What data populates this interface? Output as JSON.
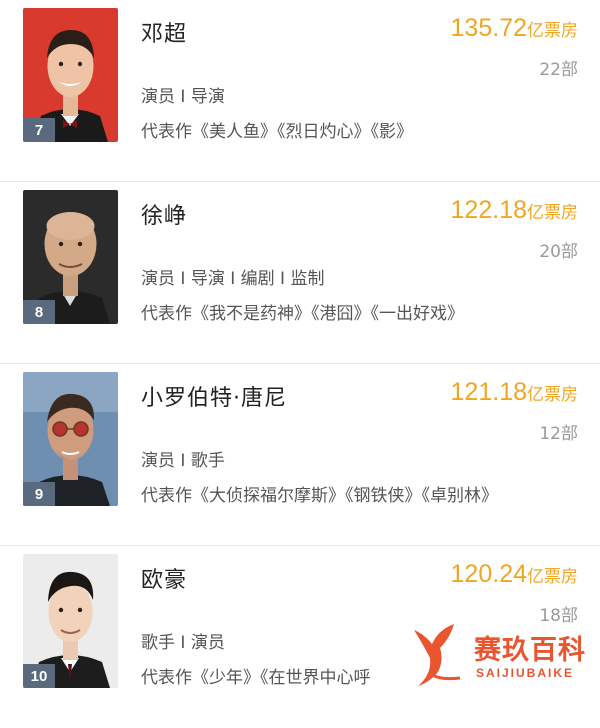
{
  "list": [
    {
      "name": "邓超",
      "box_office": "135.72",
      "box_office_unit": "亿票房",
      "film_count": "22部",
      "roles": "演员 I 导演",
      "works": "代表作《美人鱼》《烈日灼心》《影》",
      "rank": "7",
      "avatar_bg": "#d83a2e"
    },
    {
      "name": "徐峥",
      "box_office": "122.18",
      "box_office_unit": "亿票房",
      "film_count": "20部",
      "roles": "演员 I 导演 I 编剧 I 监制",
      "works": "代表作《我不是药神》《港囧》《一出好戏》",
      "rank": "8",
      "avatar_bg": "#2b2b2b"
    },
    {
      "name": "小罗伯特·唐尼",
      "box_office": "121.18",
      "box_office_unit": "亿票房",
      "film_count": "12部",
      "roles": "演员 I 歌手",
      "works": "代表作《大侦探福尔摩斯》《钢铁侠》《卓别林》",
      "rank": "9",
      "avatar_bg": "#6f8fb0"
    },
    {
      "name": "欧豪",
      "box_office": "120.24",
      "box_office_unit": "亿票房",
      "film_count": "18部",
      "roles": "歌手 I 演员",
      "works": "代表作《少年》《在世界中心呼",
      "rank": "10",
      "avatar_bg": "#ececec"
    }
  ],
  "watermark": {
    "title": "赛玖百科",
    "subtitle": "SAIJIUBAIKE"
  },
  "colors": {
    "box_office": "#f0a623",
    "rank_badge": "#596a7f",
    "watermark": "#e8552f"
  }
}
